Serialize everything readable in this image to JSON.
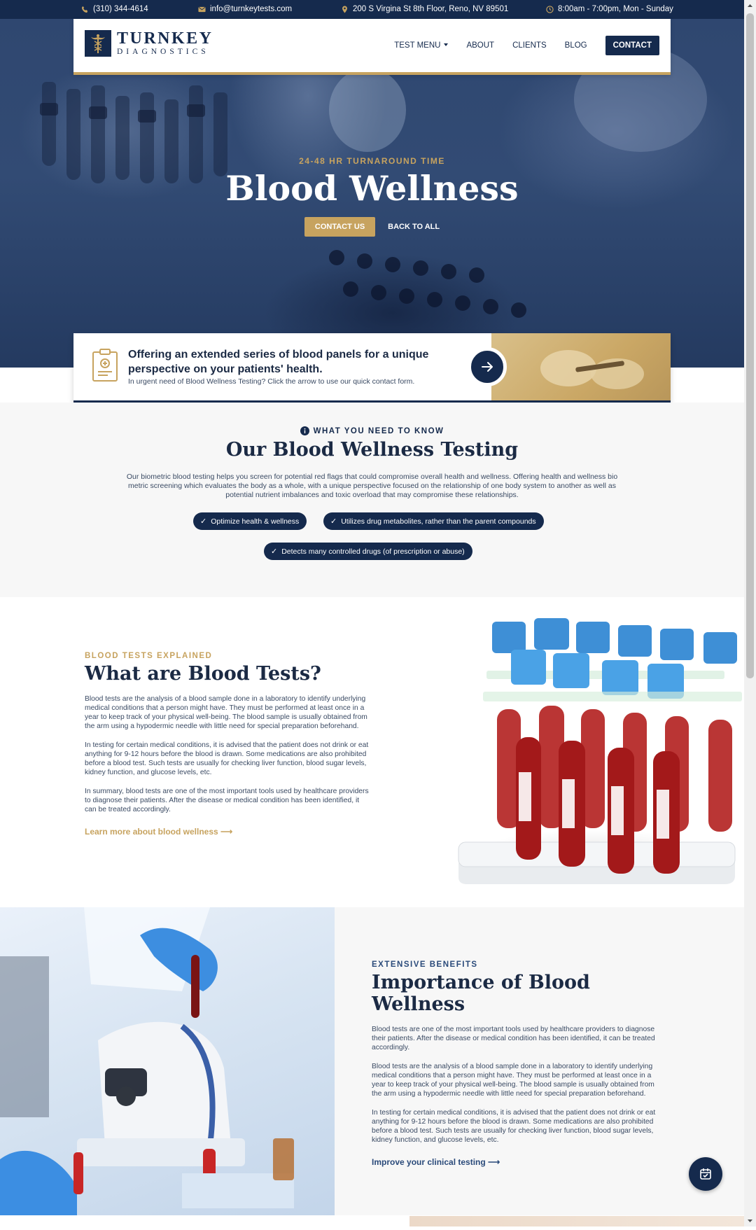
{
  "topbar": {
    "phone": "(310) 344-4614",
    "email": "info@turnkeytests.com",
    "address": "200 S Virgina St 8th Floor, Reno, NV 89501",
    "hours": "8:00am - 7:00pm, Mon - Sunday"
  },
  "brand": {
    "name": "TURNKEY",
    "sub": "DIAGNOSTICS",
    "navy": "#152a4d",
    "gold": "#c7a35f"
  },
  "nav": {
    "items": [
      "TEST MENU",
      "ABOUT",
      "CLIENTS",
      "BLOG"
    ],
    "cta": "CONTACT"
  },
  "hero": {
    "eyebrow": "24-48 HR TURNAROUND TIME",
    "title": "Blood Wellness",
    "primary_button": "CONTACT US",
    "secondary_button": "BACK TO ALL"
  },
  "offer": {
    "headline": "Offering an extended series of blood panels for a unique perspective on your patients' health.",
    "subtext": "In urgent need of Blood Wellness Testing? Click the arrow to use our quick contact form."
  },
  "know": {
    "eyebrow": "WHAT YOU NEED TO KNOW",
    "title": "Our Blood Wellness Testing",
    "paragraph": "Our biometric blood testing helps you screen for potential red flags that could compromise overall health and wellness. Offering health and wellness bio metric screening which evaluates the body as a whole, with a unique perspective focused on the relationship of one body system to another as well as potential nutrient imbalances and toxic overload that may compromise these relationships.",
    "pills": [
      "Optimize health & wellness",
      "Utilizes drug metabolites, rather than the parent compounds",
      "Detects many controlled drugs (of prescription or abuse)"
    ]
  },
  "tests": {
    "eyebrow": "BLOOD TESTS EXPLAINED",
    "title": "What are Blood Tests?",
    "paragraphs": [
      "Blood tests are the analysis of a blood sample done in a laboratory to identify underlying medical conditions that a person might have. They must be performed at least once in a year to keep track of your physical well-being. The blood sample is usually obtained from the arm using a hypodermic needle with little need for special preparation beforehand.",
      "In testing for certain medical conditions, it is advised that the patient does not drink or eat anything for 9-12 hours before the blood is drawn. Some medications are also prohibited before a blood test. Such tests are usually for checking liver function, blood sugar levels, kidney function, and glucose levels, etc.",
      "In summary, blood tests are one of the most important tools used by healthcare providers to diagnose their patients. After the disease or medical condition has been identified, it can be treated accordingly."
    ],
    "link": "Learn more about blood wellness ⟶"
  },
  "importance": {
    "eyebrow": "EXTENSIVE BENEFITS",
    "title": "Importance of Blood Wellness",
    "paragraphs": [
      "Blood tests are one of the most important tools used by healthcare providers to diagnose their patients. After the disease or medical condition has been identified, it can be treated accordingly.",
      "Blood tests are the analysis of a blood sample done in a laboratory to identify underlying medical conditions that a person might have. They must be performed at least once in a year to keep track of your physical well-being. The blood sample is usually obtained from the arm using a hypodermic needle with little need for special preparation beforehand.",
      "In testing for certain medical conditions, it is advised that the patient does not drink or eat anything for 9-12 hours before the blood is drawn. Some medications are also prohibited before a blood test. Such tests are usually for checking liver function, blood sugar levels, kidney function, and glucose levels, etc."
    ],
    "link": "Improve your clinical testing ⟶"
  }
}
